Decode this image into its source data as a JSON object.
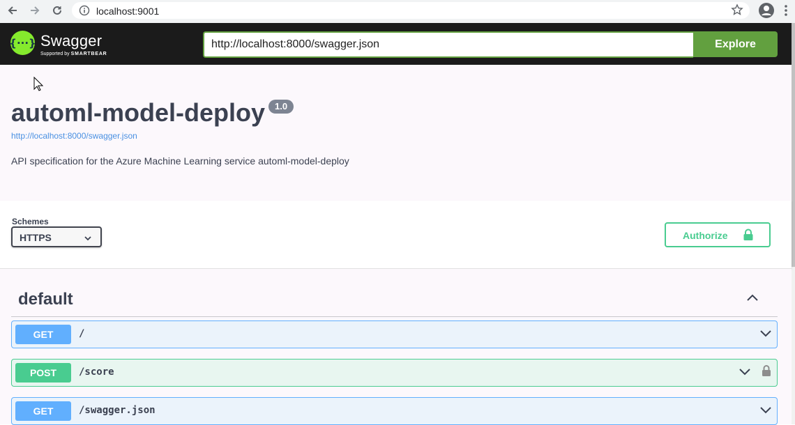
{
  "browser": {
    "url": "localhost:9001"
  },
  "topbar": {
    "brand": "Swagger",
    "brand_sub_prefix": "Supported by",
    "brand_sub_company": "SMARTBEAR",
    "spec_url": "http://localhost:8000/swagger.json",
    "explore_label": "Explore"
  },
  "info": {
    "title": "automl-model-deploy",
    "version": "1.0",
    "spec_link": "http://localhost:8000/swagger.json",
    "description": "API specification for the Azure Machine Learning service automl-model-deploy"
  },
  "schemes": {
    "label": "Schemes",
    "selected": "HTTPS"
  },
  "authorize": {
    "label": "Authorize"
  },
  "tag": {
    "name": "default"
  },
  "operations": [
    {
      "method": "GET",
      "path": "/"
    },
    {
      "method": "POST",
      "path": "/score"
    },
    {
      "method": "GET",
      "path": "/swagger.json"
    }
  ],
  "colors": {
    "get": "#61affe",
    "post": "#49cc90",
    "explore": "#62a03f",
    "topbar": "#1b1b1b"
  }
}
